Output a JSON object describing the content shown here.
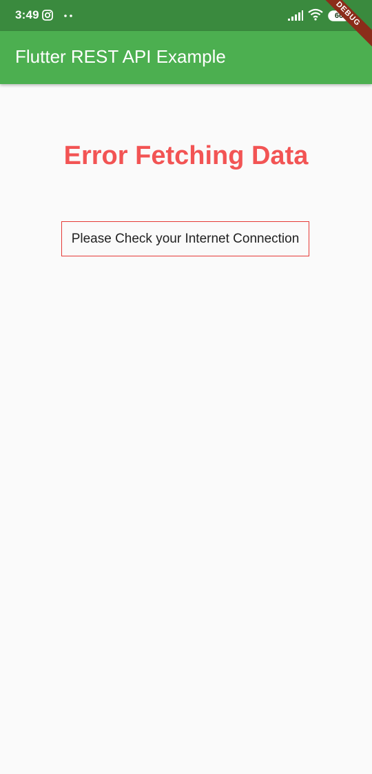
{
  "status_bar": {
    "time": "3:49",
    "battery_level": "66",
    "icons": [
      "instagram-icon",
      "more-dots-icon",
      "cell-signal-icon",
      "wifi-icon",
      "battery-icon"
    ]
  },
  "app_bar": {
    "title": "Flutter REST API Example",
    "debug_banner": "DEBUG"
  },
  "main": {
    "error_title": "Error Fetching Data",
    "error_message": "Please Check your Internet Connection"
  },
  "colors": {
    "status_bar": "#3a8a3e",
    "app_bar": "#4caf50",
    "error_title": "#f25454",
    "error_border": "#e53935",
    "background": "#fafafa"
  }
}
